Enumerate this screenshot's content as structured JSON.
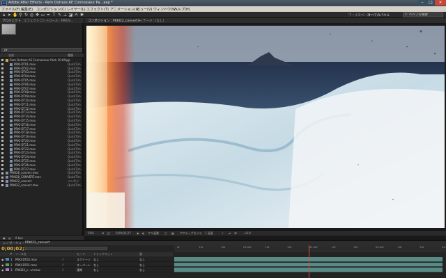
{
  "title_bar": {
    "app_icon": "Ae",
    "title": "Adobe After Effects - Rem Oxtrass AE Connosseur Pa...aep *",
    "buttons": [
      "minimize-icon",
      "maximize-icon",
      "close-icon"
    ]
  },
  "menu": [
    "ファイル(F)",
    "編集(E)",
    "コンポジション(C)",
    "レイヤー(L)",
    "エフェクト(T)",
    "アニメーション(A)",
    "ビュー(V)",
    "ウィンドウ(W)",
    "ヘルプ(H)"
  ],
  "toolbar": {
    "tools": [
      "home",
      "arrow",
      "hand",
      "zoom",
      "rotate",
      "camera",
      "pan-behind",
      "rectangle",
      "pen",
      "type",
      "brush",
      "clone-stamp",
      "eraser",
      "roto-brush",
      "puppet"
    ],
    "workspace_label": "ワークスペース :",
    "workspace_value": "すべてのパネル",
    "search_placeholder": "ヘルプを検索"
  },
  "project_panel": {
    "tabs": [
      "プロジェクト",
      "エフェクトコントロール : PRKIS..."
    ],
    "search_value": "ρ▾",
    "columns": {
      "name": "名前",
      "type": "種類"
    },
    "folder_name": "Rem Oxtrass AE Connosseur Pack 20.8%pp",
    "files": [
      {
        "name": "PRKI-DT01.mov",
        "type": "QuickTim"
      },
      {
        "name": "PRKI-DT02.mov",
        "type": "QuickTim"
      },
      {
        "name": "PRKI-DT03.mov",
        "type": "QuickTim"
      },
      {
        "name": "PRKI-DT04.mov",
        "type": "QuickTim"
      },
      {
        "name": "PRKI-DT05.mov",
        "type": "QuickTim"
      },
      {
        "name": "PRKI-DT06.mov",
        "type": "QuickTim"
      },
      {
        "name": "PRKI-DT07.mov",
        "type": "QuickTim"
      },
      {
        "name": "PRKI-DT08.mov",
        "type": "QuickTim"
      },
      {
        "name": "PRKI-DT09.mov",
        "type": "QuickTim"
      },
      {
        "name": "PRKI-DT10.mov",
        "type": "QuickTim"
      },
      {
        "name": "PRKI-DT11.mov",
        "type": "QuickTim"
      },
      {
        "name": "PRKI-DT12.mov",
        "type": "QuickTim"
      },
      {
        "name": "PRKI-DT13.mov",
        "type": "QuickTim"
      },
      {
        "name": "PRKI-DT14.mov",
        "type": "QuickTim"
      },
      {
        "name": "PRKI-DT15.mov",
        "type": "QuickTim"
      },
      {
        "name": "PRKI-DT16.mov",
        "type": "QuickTim"
      },
      {
        "name": "PRKI-DT17.mov",
        "type": "QuickTim"
      },
      {
        "name": "PRKI-DT18.mov",
        "type": "QuickTim"
      },
      {
        "name": "PRKI-DT19.mov",
        "type": "QuickTim"
      },
      {
        "name": "PRKI-DT20.mov",
        "type": "QuickTim"
      },
      {
        "name": "PRKI-DT21.mov",
        "type": "QuickTim"
      },
      {
        "name": "PRKI-DT22.mov",
        "type": "QuickTim"
      },
      {
        "name": "PRKI-DT23.mov",
        "type": "QuickTim"
      },
      {
        "name": "PRKI-DT24.mov",
        "type": "QuickTim"
      },
      {
        "name": "PRKI-DT25.mov",
        "type": "QuickTim"
      },
      {
        "name": "PRKI-DT26.mov",
        "type": "QuickTim"
      },
      {
        "name": "PRKI-DT27.mov",
        "type": "QuickTim"
      }
    ],
    "extra_items": [
      {
        "name": "PRKI28_convert.mov",
        "type": "QuickTim",
        "kind": "file"
      },
      {
        "name": "PRKI28_CONVERT.mov",
        "type": "QuickTim",
        "kind": "file"
      },
      {
        "name": "PRKI22_convert",
        "type": "コンポジ",
        "kind": "comp"
      },
      {
        "name": "PRKI22_convert.mov",
        "type": "QuickTim",
        "kind": "file"
      }
    ],
    "footer": [
      "8 bpc",
      "▾"
    ]
  },
  "viewer": {
    "tabs": [
      "コンポジション : PRKI22_convert ▾",
      "フッテージ : (なし)"
    ],
    "footer": {
      "zoom": "50%",
      "timecode": "0;00;02;27",
      "resolution": "フル画質",
      "camera": "アクティブカメラ",
      "views": "1 画面",
      "offset": "+0.0"
    }
  },
  "timeline": {
    "tabs": [
      "レンダーキュー",
      "PRKI22_convert"
    ],
    "timecode": "0;00;02;27",
    "header": {
      "num": "#",
      "source": "ソース名",
      "mode": "モード",
      "trkmat": "トラックマット",
      "parent": "親"
    },
    "layers": [
      {
        "index": "1",
        "name": "PRKI-DT02.mov",
        "mode": "スクリーン",
        "trk": "なし",
        "parent": "なし",
        "label_color": "#4a86b8"
      },
      {
        "index": "2",
        "name": "PRKI-DT01.mov",
        "mode": "オーバーレ",
        "trk": "なし",
        "parent": "なし",
        "label_color": "#5aa05a"
      },
      {
        "index": "3",
        "name": "PRKI22_c...vt.mov",
        "mode": "通常",
        "trk": "なし",
        "parent": "なし",
        "label_color": "#a77ad0"
      }
    ],
    "ruler": [
      "0f",
      "10f",
      "20f",
      "01:00f",
      "10f",
      "20f",
      "02:00f",
      "10f",
      "20f",
      "03:00f",
      "10f",
      "20f",
      "04:00f"
    ],
    "playhead_fraction": 0.5
  }
}
